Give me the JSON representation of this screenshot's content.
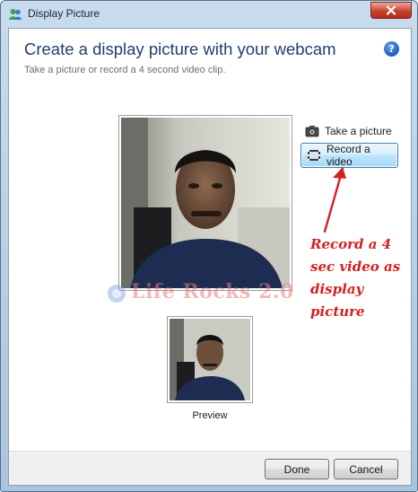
{
  "window": {
    "title": "Display Picture",
    "close_label": "✕"
  },
  "header": {
    "title": "Create a display picture with your webcam",
    "subtitle": "Take a picture or record a 4 second video clip.",
    "help_label": "?"
  },
  "actions": {
    "take_picture": "Take a picture",
    "record_video": "Record a video"
  },
  "watermark": "Life Rocks 2.0",
  "annotation": {
    "lines": [
      "Record a 4",
      "sec video as",
      "display",
      "picture"
    ]
  },
  "preview": {
    "label": "Preview"
  },
  "footer": {
    "done": "Done",
    "cancel": "Cancel"
  },
  "colors": {
    "heading": "#1e3f6e",
    "annotation": "#d42020",
    "selected_button": "#bee6fd"
  }
}
